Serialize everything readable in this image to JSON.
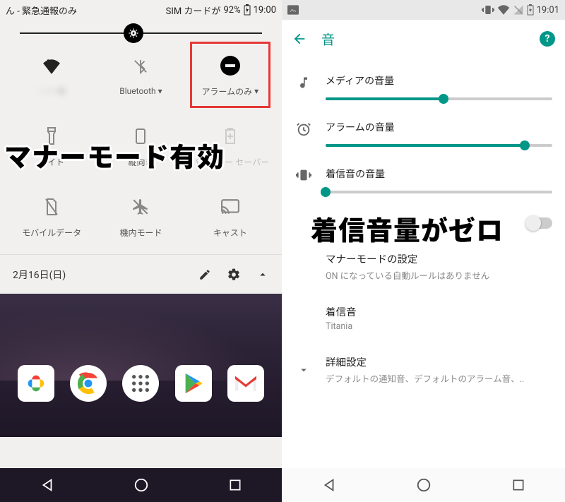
{
  "left": {
    "statusbar": {
      "carrier": "ん - 緊急通報のみ",
      "sim": "SIM カードが",
      "battery": "92%",
      "time": "19:00"
    },
    "qs": {
      "row1": [
        {
          "label_blur": "········",
          "dropdown": true
        },
        {
          "label": "Bluetooth",
          "dropdown": true
        },
        {
          "label": "アラームのみ",
          "dropdown": true
        }
      ],
      "row2": [
        {
          "label": "ライト"
        },
        {
          "label": "縦向き"
        },
        {
          "label": "バッテリー セーバー"
        }
      ],
      "row3": [
        {
          "label": "モバイルデータ"
        },
        {
          "label": "機内モード"
        },
        {
          "label": "キャスト"
        }
      ]
    },
    "footer": {
      "date": "2月16日(日)"
    },
    "overlay": "マナーモード有効"
  },
  "right": {
    "statusbar": {
      "time": "19:01"
    },
    "appbar": {
      "title": "音"
    },
    "sliders": {
      "media": {
        "label": "メディアの音量",
        "pct": 52
      },
      "alarm": {
        "label": "アラームの音量",
        "pct": 88
      },
      "ring": {
        "label": "着信音の音量",
        "pct": 0
      }
    },
    "rows": {
      "dnd": {
        "title": "マナーモードの設定",
        "sub": "ON になっている自動ルールはありません"
      },
      "tone": {
        "title": "着信音",
        "sub": "Titania"
      },
      "adv": {
        "title": "詳細設定",
        "sub": "デフォルトの通知音、デフォルトのアラーム音、.."
      }
    },
    "overlay": "着信音量がゼロ"
  }
}
